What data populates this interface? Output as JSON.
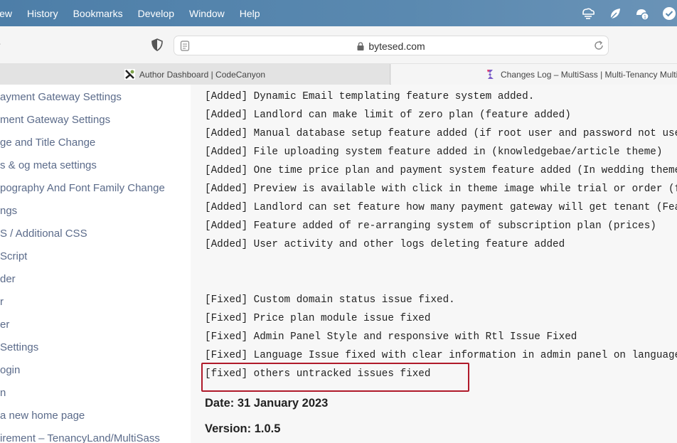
{
  "menubar": {
    "items": [
      "iew",
      "History",
      "Bookmarks",
      "Develop",
      "Window",
      "Help"
    ],
    "status_icons": [
      "cloud-sync-icon",
      "leaf-icon",
      "notification-icon",
      "check-circle-icon"
    ]
  },
  "toolbar": {
    "url": "bytesed.com"
  },
  "tabs": [
    {
      "title": "Author Dashboard | CodeCanyon"
    },
    {
      "title": "Changes Log – MultiSass | Multi-Tenancy Multip"
    }
  ],
  "sidebar": {
    "items": [
      "ayment Gateway Settings",
      "ment Gateway Settings",
      "ge and Title Change",
      "s & og meta settings",
      "pography And Font Family Change",
      "ngs",
      "S / Additional CSS",
      "Script",
      "der",
      "r",
      "er",
      "Settings",
      "ogin",
      "n",
      "a new home page",
      "irement – TenancyLand/MultiSass"
    ]
  },
  "changelog": {
    "added": [
      "[Added] Dynamic Email templating feature system added.",
      "[Added] Landlord can make limit of zero plan (feature added)",
      "[Added] Manual database setup feature added (if root user and password not uses",
      "[Added] File uploading system feature added in (knowledgebae/article theme)",
      "[Added] One time price plan and payment system feature added (In wedding theme)",
      "[Added] Preview is available with click in theme image while trial or order (fe",
      "[Added] Landlord can set feature how many payment gateway will get tenant (Feat",
      "[Added] Feature added of re-arranging system of subscription plan (prices)",
      "[Added] User activity and other logs deleting feature added"
    ],
    "fixed": [
      "[Fixed] Custom domain status issue fixed.",
      "[Fixed] Price plan module issue fixed",
      "[Fixed] Admin Panel Style and responsive with Rtl Issue Fixed",
      "[Fixed] Language Issue fixed with clear information in admin panel on language"
    ],
    "highlighted": "[fixed] others untracked issues fixed",
    "date_heading": "Date: 31 January 2023",
    "version_heading": "Version: 1.0.5"
  },
  "colors": {
    "menubar": "#5a89b0",
    "sidebar_text": "#5b6b8a",
    "highlight_border": "#b01a2a",
    "content_bg": "#f7f7f7"
  }
}
